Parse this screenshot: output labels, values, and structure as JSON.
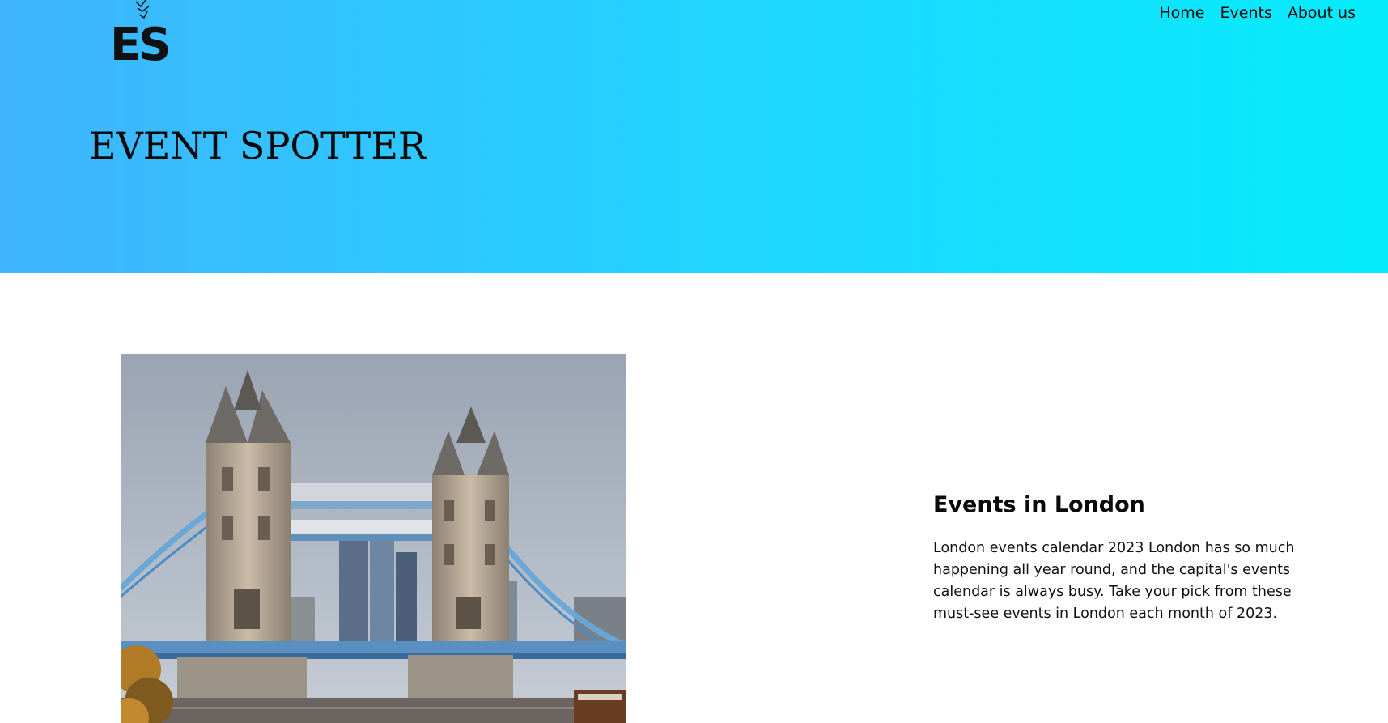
{
  "brand": {
    "logo_text": "ES",
    "site_title": "EVENT SPOTTER"
  },
  "nav": {
    "items": [
      {
        "label": "Home"
      },
      {
        "label": "Events"
      },
      {
        "label": "About us"
      }
    ]
  },
  "hero": {
    "image_icon": "tower-bridge-photo"
  },
  "intro": {
    "heading": "Events in London",
    "body": "London events calendar 2023 London has so much happening all year round, and the capital's events calendar is always busy. Take your pick from these must-see events in London each month of 2023."
  },
  "colors": {
    "header_gradient_start": "#40b4fe",
    "header_gradient_end": "#05ecfb",
    "text": "#0a0a0a",
    "background": "#ffffff"
  }
}
